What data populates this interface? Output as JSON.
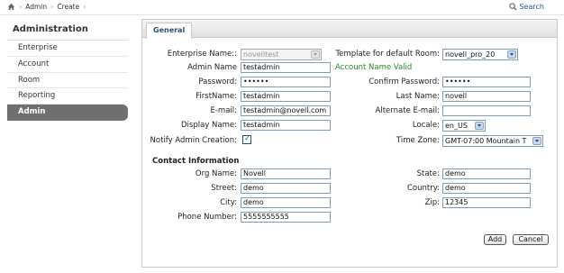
{
  "breadcrumb": {
    "items": [
      "Admin",
      "Create"
    ]
  },
  "search": {
    "label": "Search"
  },
  "sidebar": {
    "title": "Administration",
    "items": [
      {
        "label": "Enterprise"
      },
      {
        "label": "Account"
      },
      {
        "label": "Room"
      },
      {
        "label": "Reporting"
      },
      {
        "label": "Admin",
        "active": true
      }
    ]
  },
  "tabs": [
    {
      "label": "General"
    }
  ],
  "form": {
    "enterprise_name_label": "Enterprise Name::",
    "enterprise_name_value": "novelltest",
    "template_label": "Template for default Room:",
    "template_value": "novell_pro_20",
    "admin_name_label": "Admin Name",
    "admin_name_value": "testadmin",
    "account_valid_text": "Account Name Valid",
    "password_label": "Password:",
    "password_value": "••••••",
    "confirm_password_label": "Confirm Password:",
    "confirm_password_value": "••••••",
    "first_name_label": "FirstName:",
    "first_name_value": "testadmin",
    "last_name_label": "Last Name:",
    "last_name_value": "novell",
    "email_label": "E-mail:",
    "email_value": "testadmin@novell.com",
    "alt_email_label": "Alternate E-mail:",
    "alt_email_value": "",
    "display_name_label": "Display Name:",
    "display_name_value": "testadmin",
    "locale_label": "Locale:",
    "locale_value": "en_US",
    "notify_label": "Notify Admin Creation:",
    "notify_checked": true,
    "timezone_label": "Time Zone:",
    "timezone_value": "GMT-07:00 Mountain T"
  },
  "contact": {
    "title": "Contact Information",
    "org_name_label": "Org Name:",
    "org_name_value": "Novell",
    "state_label": "State:",
    "state_value": "demo",
    "street_label": "Street:",
    "street_value": "demo",
    "country_label": "Country:",
    "country_value": "demo",
    "city_label": "City:",
    "city_value": "demo",
    "zip_label": "Zip:",
    "zip_value": "12345",
    "phone_label": "Phone Number:",
    "phone_value": "5555555555"
  },
  "buttons": {
    "add": "Add",
    "cancel": "Cancel"
  },
  "colors": {
    "valid_text": "#2a8a2a",
    "active_nav": "#6f6f6f",
    "tab_text": "#2a4e7a",
    "link": "#2255aa"
  }
}
